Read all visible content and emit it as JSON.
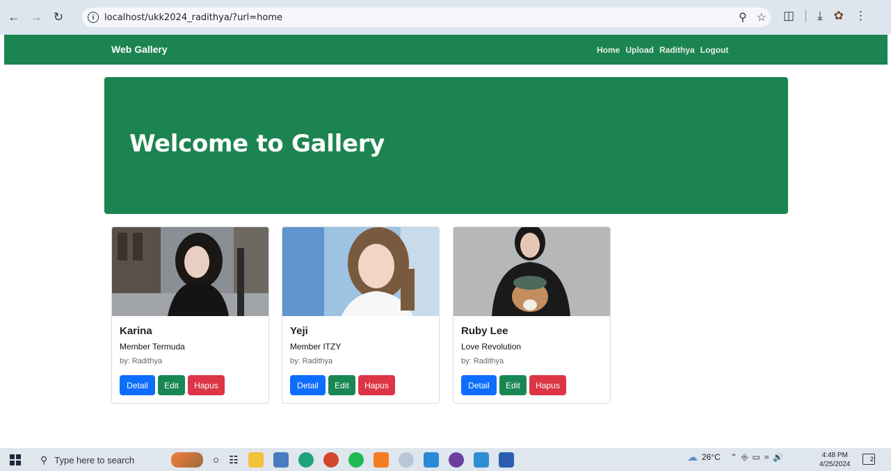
{
  "browser": {
    "url": "localhost/ukk2024_radithya/?url=home"
  },
  "navbar": {
    "brand": "Web Gallery",
    "links": [
      "Home",
      "Upload",
      "Radithya",
      "Logout"
    ]
  },
  "hero": {
    "title": "Welcome to Gallery"
  },
  "cards": [
    {
      "title": "Karina",
      "subtitle": "Member Termuda",
      "author": "by: Radithya",
      "buttons": {
        "detail": "Detail",
        "edit": "Edit",
        "hapus": "Hapus"
      }
    },
    {
      "title": "Yeji",
      "subtitle": "Member ITZY",
      "author": "by: Radithya",
      "buttons": {
        "detail": "Detail",
        "edit": "Edit",
        "hapus": "Hapus"
      }
    },
    {
      "title": "Ruby Lee",
      "subtitle": "Love Revolution",
      "author": "by: Radithya",
      "buttons": {
        "detail": "Detail",
        "edit": "Edit",
        "hapus": "Hapus"
      }
    }
  ],
  "taskbar": {
    "search_placeholder": "Type here to search",
    "temperature": "26°C",
    "time": "4:48 PM",
    "date": "4/25/2024",
    "notification_count": "2"
  },
  "colors": {
    "brand_green": "#1c8450",
    "detail_blue": "#0d6efd",
    "edit_green": "#198754",
    "hapus_red": "#dc3545"
  }
}
